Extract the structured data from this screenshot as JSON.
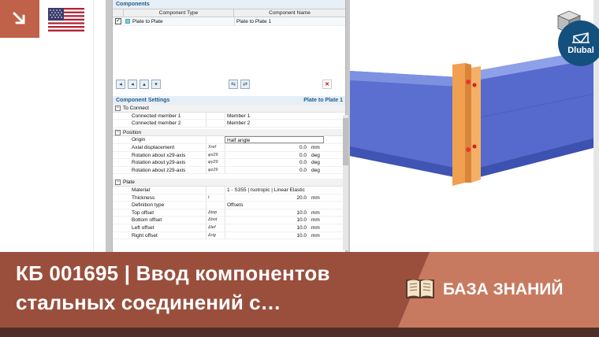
{
  "components": {
    "section_title": "Components",
    "col_type": "Component Type",
    "col_name": "Component Name",
    "rows": [
      {
        "type": "Plate to Plate",
        "name": "Plate to Plate 1"
      }
    ]
  },
  "settings": {
    "section_title": "Component Settings",
    "section_right": "Plate to Plate 1",
    "groups": {
      "to_connect": "To Connect",
      "position": "Position",
      "plate": "Plate"
    },
    "to_connect_rows": [
      {
        "label": "Connected member 1",
        "sym": "",
        "value": "Member 1",
        "unit": ""
      },
      {
        "label": "Connected member 2",
        "sym": "",
        "value": "Member 2",
        "unit": ""
      }
    ],
    "position_rows": [
      {
        "label": "Origin",
        "sym": "",
        "value": "Half angle",
        "unit": ""
      },
      {
        "label": "Axial displacement",
        "sym": "Xref",
        "value": "0.0",
        "unit": "mm"
      },
      {
        "label": "Rotation about x29-axis",
        "sym": "φx29",
        "value": "0.0",
        "unit": "deg"
      },
      {
        "label": "Rotation about y29-axis",
        "sym": "φy29",
        "value": "0.0",
        "unit": "deg"
      },
      {
        "label": "Rotation about z29-axis",
        "sym": "φz29",
        "value": "0.0",
        "unit": "deg"
      }
    ],
    "plate_rows": [
      {
        "label": "Material",
        "sym": "",
        "value": "1 - S355 | Isotropic | Linear Elastic",
        "unit": ""
      },
      {
        "label": "Thickness",
        "sym": "t",
        "value": "20.0",
        "unit": "mm"
      },
      {
        "label": "Definition type",
        "sym": "",
        "value": "Offsets",
        "unit": ""
      },
      {
        "label": "Top offset",
        "sym": "Δtop",
        "value": "10.0",
        "unit": "mm"
      },
      {
        "label": "Bottom offset",
        "sym": "Δbot",
        "value": "10.0",
        "unit": "mm"
      },
      {
        "label": "Left offset",
        "sym": "Δlef",
        "value": "10.0",
        "unit": "mm"
      },
      {
        "label": "Right offset",
        "sym": "Δrig",
        "value": "10.0",
        "unit": "mm"
      }
    ]
  },
  "logo": {
    "brand": "Dlubal"
  },
  "banner": {
    "title_line1": "КБ 001695 | Ввод компонентов",
    "title_line2": "стальных соединений с…",
    "category": "БАЗА ЗНАНИЙ"
  },
  "colors": {
    "accent": "#9a4f3d",
    "accent_light": "#c87a60",
    "brand_blue": "#14507d",
    "beam_blue": "#5b6fc9",
    "plate_orange": "#f0a050"
  }
}
